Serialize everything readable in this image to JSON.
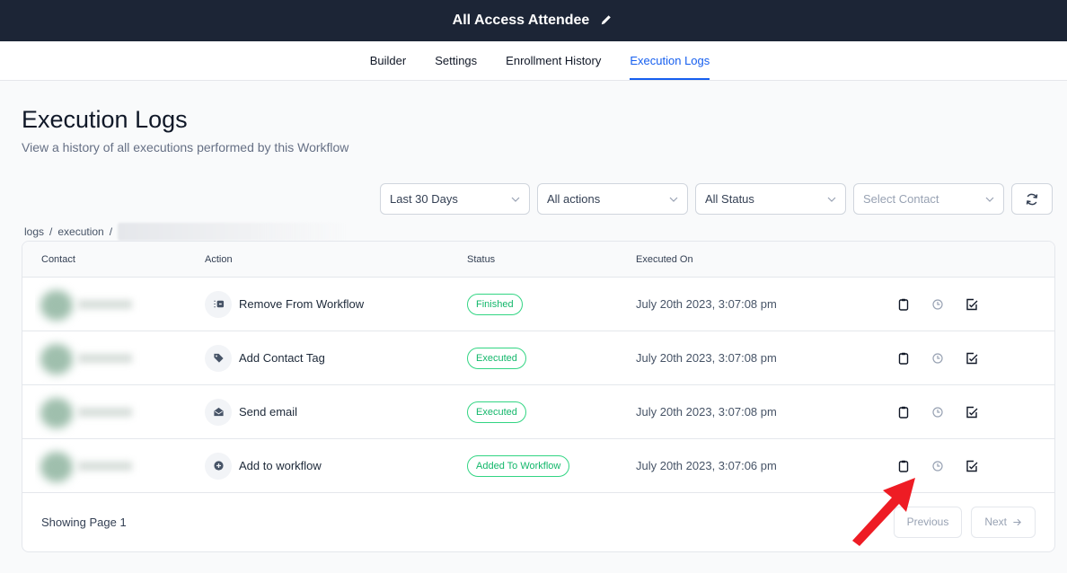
{
  "header": {
    "title": "All Access Attendee"
  },
  "tabs": [
    {
      "label": "Builder"
    },
    {
      "label": "Settings"
    },
    {
      "label": "Enrollment History"
    },
    {
      "label": "Execution Logs"
    }
  ],
  "page": {
    "title": "Execution Logs",
    "subtitle": "View a history of all executions performed by this Workflow"
  },
  "filters": {
    "date": "Last 30 Days",
    "actions": "All actions",
    "status": "All Status",
    "contact_placeholder": "Select Contact"
  },
  "breadcrumb": {
    "part1": "logs",
    "sep": "/",
    "part2": "execution"
  },
  "table": {
    "headers": {
      "contact": "Contact",
      "action": "Action",
      "status": "Status",
      "executed_on": "Executed On"
    },
    "rows": [
      {
        "action": "Remove From Workflow",
        "status": "Finished",
        "executed_on": "July 20th 2023, 3:07:08 pm"
      },
      {
        "action": "Add Contact Tag",
        "status": "Executed",
        "executed_on": "July 20th 2023, 3:07:08 pm"
      },
      {
        "action": "Send email",
        "status": "Executed",
        "executed_on": "July 20th 2023, 3:07:08 pm"
      },
      {
        "action": "Add to workflow",
        "status": "Added To Workflow",
        "executed_on": "July 20th 2023, 3:07:06 pm"
      }
    ]
  },
  "footer": {
    "info": "Showing Page 1",
    "previous": "Previous",
    "next": "Next"
  },
  "colors": {
    "topbar": "#1c2536",
    "accent": "#155eef",
    "success": "#12b76a",
    "annotation_arrow": "#ee1c24"
  }
}
